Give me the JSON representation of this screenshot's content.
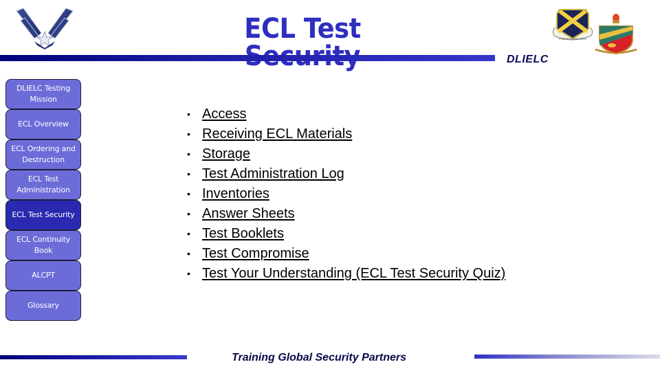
{
  "header": {
    "title": "ECL Test Security",
    "org_label": "DLIELC",
    "logos": {
      "left": "air-force-symbol",
      "right_1": "37th-training-wing-emblem",
      "right_2": "dlielc-crest"
    }
  },
  "sidebar": {
    "items": [
      {
        "label": "DLIELC Testing Mission",
        "active": false
      },
      {
        "label": "ECL Overview",
        "active": false
      },
      {
        "label": "ECL Ordering and Destruction",
        "active": false
      },
      {
        "label": "ECL Test Administration",
        "active": false
      },
      {
        "label": "ECL Test Security",
        "active": true
      },
      {
        "label": "ECL Continuity Book",
        "active": false
      },
      {
        "label": "ALCPT",
        "active": false
      },
      {
        "label": "Glossary",
        "active": false
      }
    ]
  },
  "main": {
    "bullet_glyph": "•",
    "links": [
      "Access",
      "Receiving ECL Materials",
      "Storage",
      "Test Administration Log",
      "Inventories",
      "Answer Sheets",
      "Test Booklets",
      "Test Compromise",
      "Test Your Understanding (ECL Test Security Quiz)"
    ]
  },
  "footer": {
    "tagline": "Training Global Security Partners"
  },
  "colors": {
    "title": "#2e2ec0",
    "nav_button": "#6c6cd8",
    "nav_button_active": "#2a2ab0",
    "bar_dark": "#00007a",
    "bar_light": "#3535cc"
  }
}
